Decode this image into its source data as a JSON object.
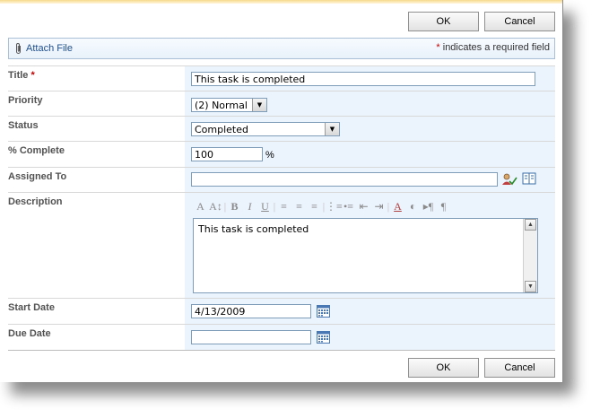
{
  "buttons": {
    "ok": "OK",
    "cancel": "Cancel"
  },
  "toolbar": {
    "attach_label": "Attach File",
    "required_star": "*",
    "required_text": "indicates a required field"
  },
  "fields": {
    "title": {
      "label": "Title",
      "required_marker": "*",
      "value": "This task is completed"
    },
    "priority": {
      "label": "Priority",
      "value": "(2) Normal"
    },
    "status": {
      "label": "Status",
      "value": "Completed"
    },
    "percent_complete": {
      "label": "% Complete",
      "value": "100",
      "suffix": "%"
    },
    "assigned_to": {
      "label": "Assigned To",
      "value": ""
    },
    "description": {
      "label": "Description",
      "value": "This task is completed"
    },
    "start_date": {
      "label": "Start Date",
      "value": "4/13/2009"
    },
    "due_date": {
      "label": "Due Date",
      "value": ""
    }
  },
  "colors": {
    "field_bg": "#ebf3fd",
    "required": "#c00000",
    "link": "#1f4f8c"
  }
}
